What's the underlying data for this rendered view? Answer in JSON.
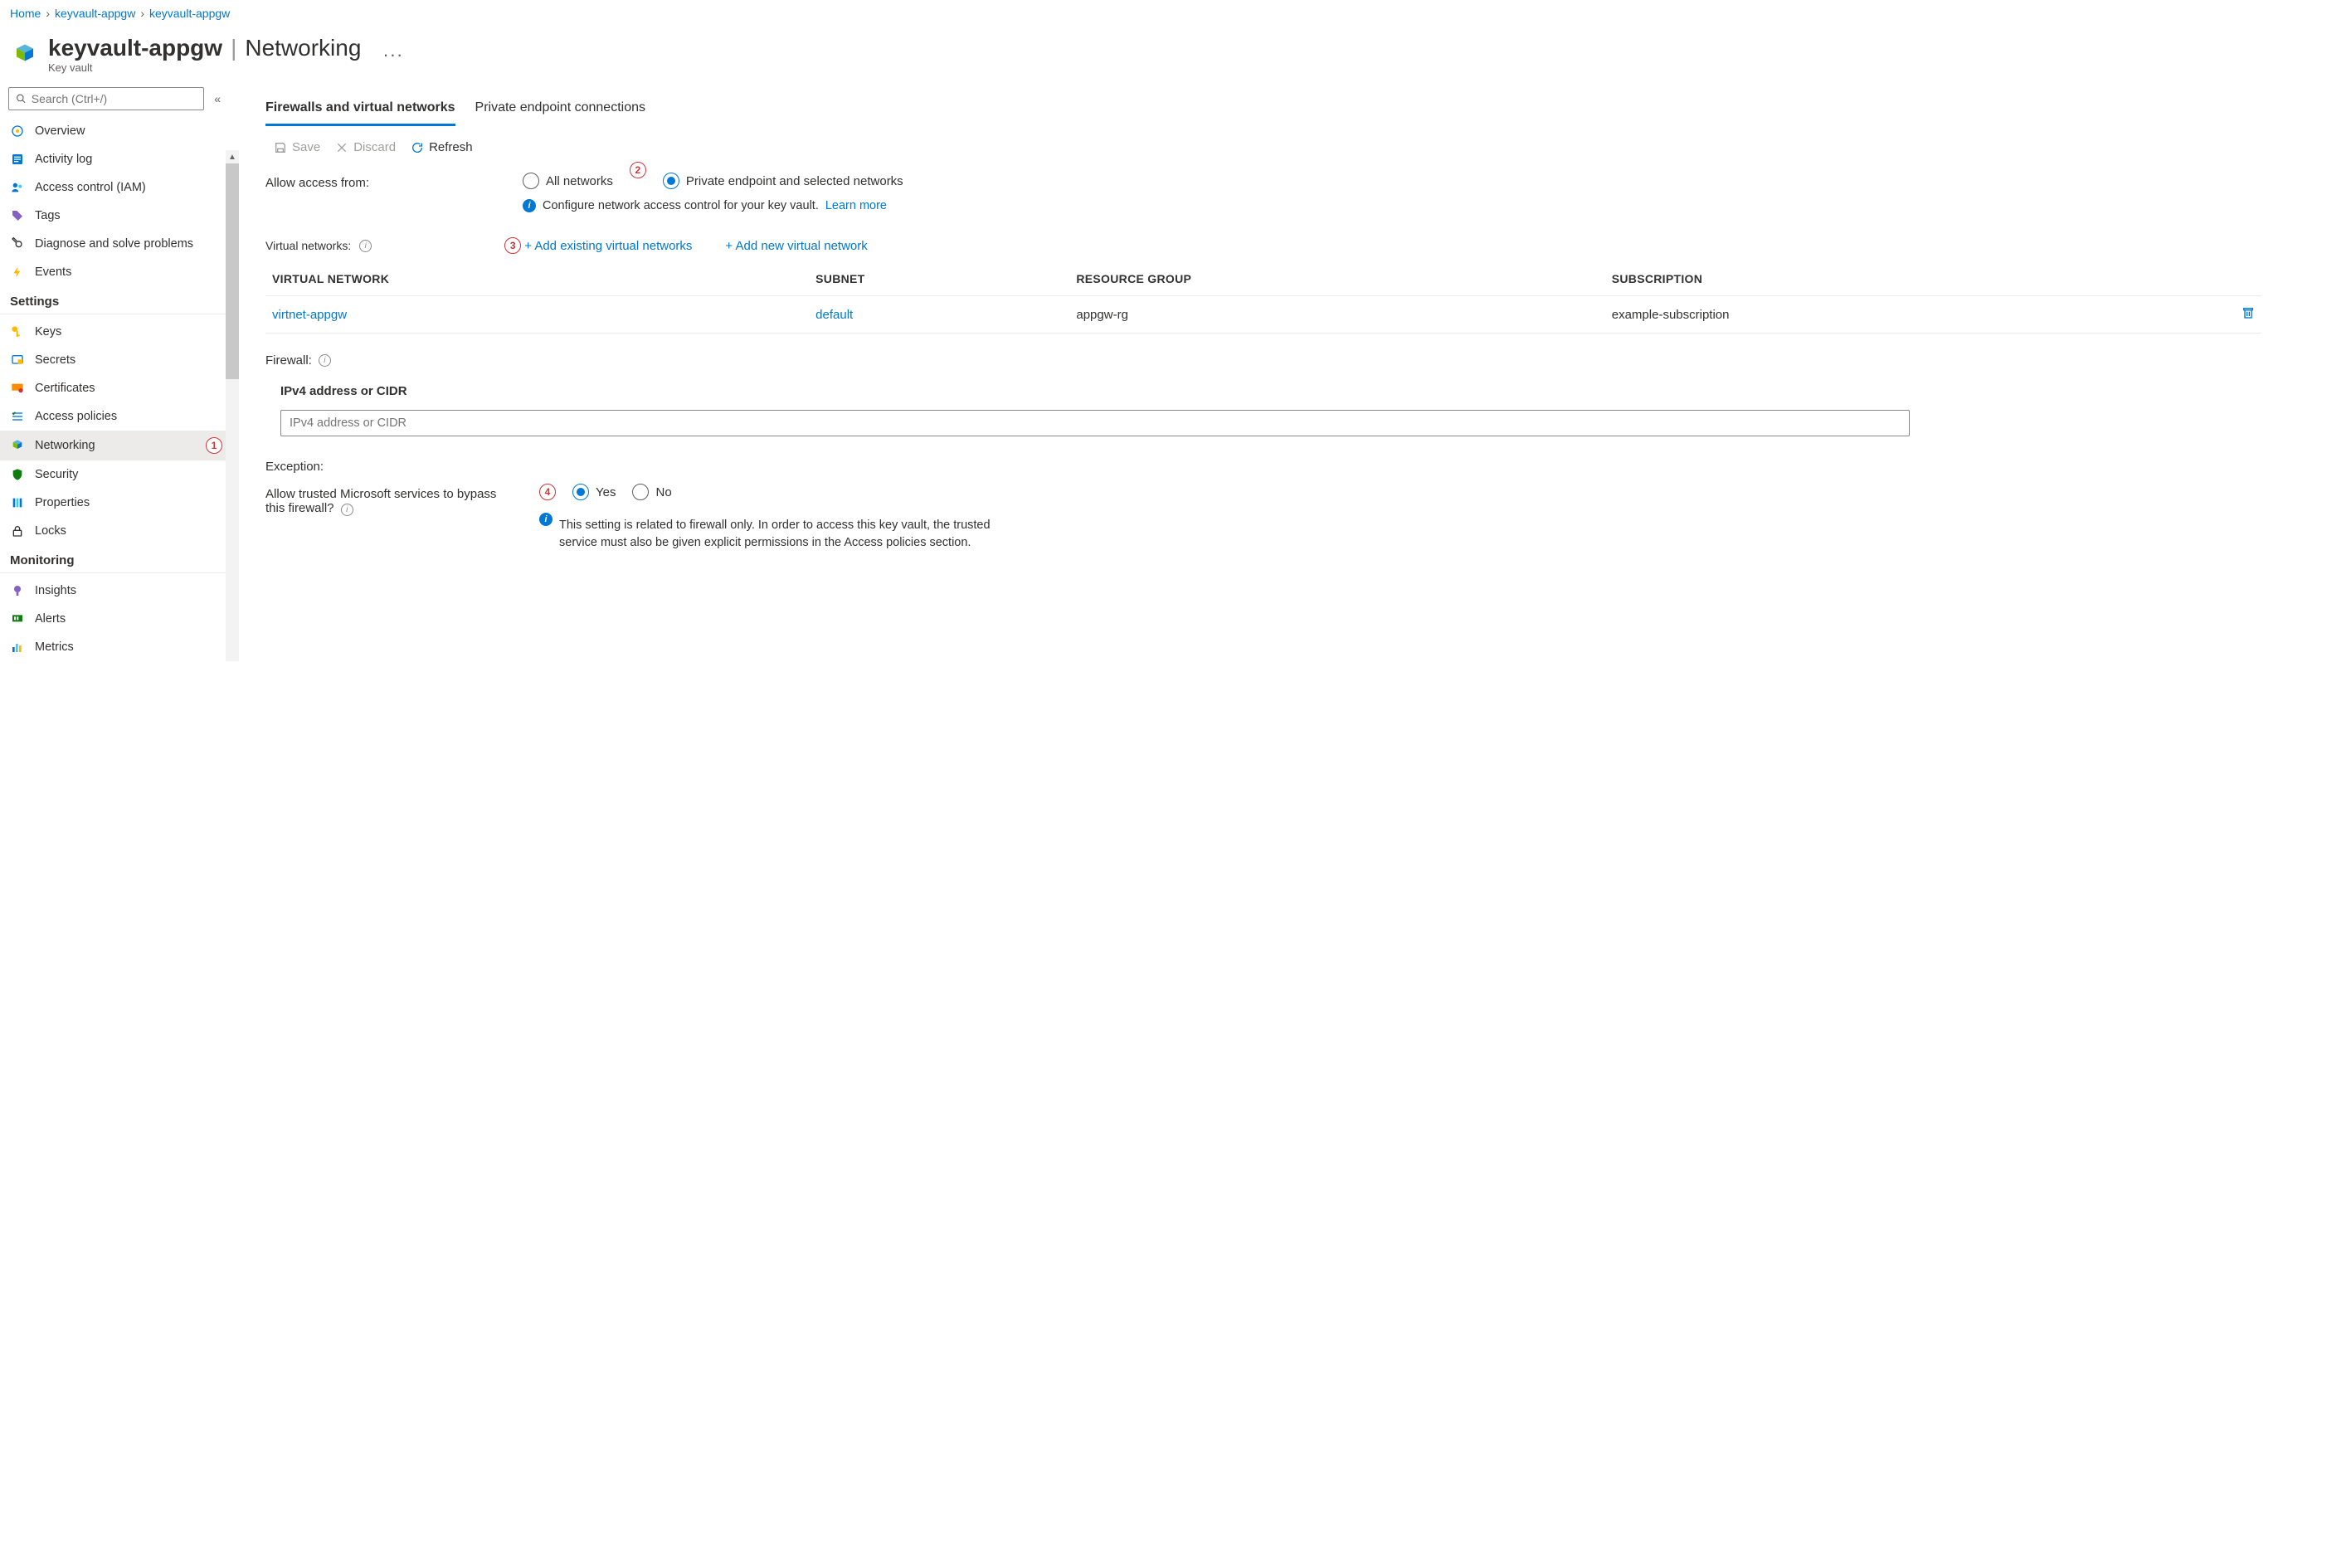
{
  "breadcrumb": {
    "home": "Home",
    "lvl1": "keyvault-appgw",
    "lvl2": "keyvault-appgw"
  },
  "header": {
    "title": "keyvault-appgw",
    "section": "Networking",
    "subtitle": "Key vault"
  },
  "search": {
    "placeholder": "Search (Ctrl+/)"
  },
  "nav": {
    "overview": "Overview",
    "activity_log": "Activity log",
    "access_control": "Access control (IAM)",
    "tags": "Tags",
    "diagnose": "Diagnose and solve problems",
    "events": "Events",
    "settings_title": "Settings",
    "keys": "Keys",
    "secrets": "Secrets",
    "certificates": "Certificates",
    "access_policies": "Access policies",
    "networking": "Networking",
    "security": "Security",
    "properties": "Properties",
    "locks": "Locks",
    "monitoring_title": "Monitoring",
    "insights": "Insights",
    "alerts": "Alerts",
    "metrics": "Metrics"
  },
  "tabs": {
    "t0": "Firewalls and virtual networks",
    "t1": "Private endpoint connections"
  },
  "toolbar": {
    "save": "Save",
    "discard": "Discard",
    "refresh": "Refresh"
  },
  "access": {
    "label": "Allow access from:",
    "opt_all": "All networks",
    "opt_private": "Private endpoint and selected networks",
    "info": "Configure network access control for your key vault.",
    "learn_more": "Learn more"
  },
  "vnet": {
    "label": "Virtual networks:",
    "add_existing": "+ Add existing virtual networks",
    "add_new": "+ Add new virtual network",
    "col_vn": "VIRTUAL NETWORK",
    "col_subnet": "SUBNET",
    "col_rg": "RESOURCE GROUP",
    "col_sub": "SUBSCRIPTION",
    "row0": {
      "vn": "virtnet-appgw",
      "subnet": "default",
      "rg": "appgw-rg",
      "sub": "example-subscription"
    }
  },
  "firewall": {
    "label": "Firewall:",
    "ipv4_label": "IPv4 address or CIDR",
    "ipv4_placeholder": "IPv4 address or CIDR"
  },
  "exception": {
    "title": "Exception:",
    "question": "Allow trusted Microsoft services to bypass this firewall?",
    "yes": "Yes",
    "no": "No",
    "info": "This setting is related to firewall only. In order to access this key vault, the trusted service must also be given explicit permissions in the Access policies section."
  },
  "markers": {
    "m1": "1",
    "m2": "2",
    "m3": "3",
    "m4": "4"
  }
}
